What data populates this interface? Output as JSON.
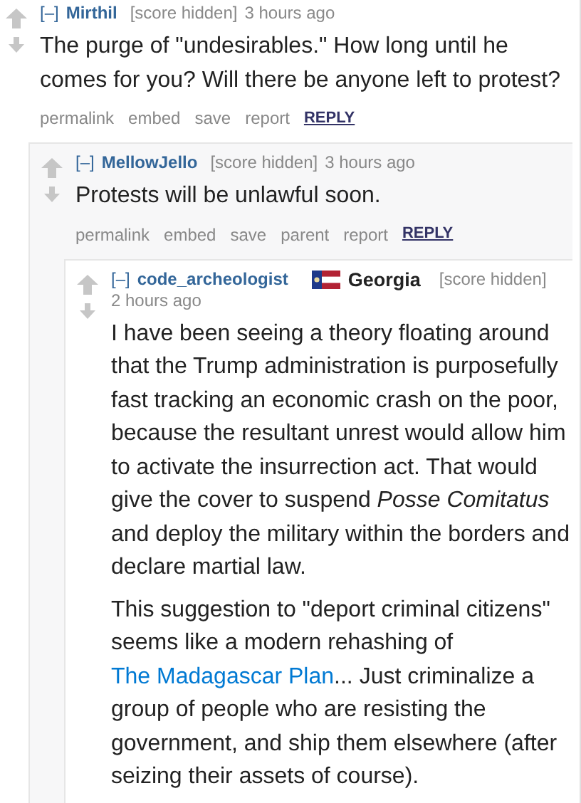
{
  "comments": [
    {
      "collapse": "[–]",
      "author": "Mirthil",
      "score": "[score hidden]",
      "time": "3 hours ago",
      "body": [
        [
          {
            "text": "The purge of \"undesirables.\" How long until he comes for you? Will there be anyone left to protest?"
          }
        ]
      ],
      "actions": [
        {
          "label": "permalink",
          "kind": "plain"
        },
        {
          "label": "embed",
          "kind": "plain"
        },
        {
          "label": "save",
          "kind": "plain"
        },
        {
          "label": "report",
          "kind": "plain"
        },
        {
          "label": "REPLY",
          "kind": "reply"
        }
      ],
      "children": [
        {
          "collapse": "[–]",
          "author": "MellowJello",
          "score": "[score hidden]",
          "time": "3 hours ago",
          "body": [
            [
              {
                "text": "Protests will be unlawful soon."
              }
            ]
          ],
          "actions": [
            {
              "label": "permalink",
              "kind": "plain"
            },
            {
              "label": "embed",
              "kind": "plain"
            },
            {
              "label": "save",
              "kind": "plain"
            },
            {
              "label": "parent",
              "kind": "plain"
            },
            {
              "label": "report",
              "kind": "plain"
            },
            {
              "label": "REPLY",
              "kind": "reply"
            }
          ],
          "children": [
            {
              "collapse": "[–]",
              "author": "code_archeologist",
              "flair": "Georgia",
              "score": "[score hidden]",
              "time": "2 hours ago",
              "body": [
                [
                  {
                    "text": "I have been seeing a theory floating around that the Trump administration is purposefully fast tracking an economic crash on the poor, because the resultant unrest would allow him to activate the insurrection act. That would give the cover to suspend *Posse Comitatus* and deploy the military within the borders and declare martial law."
                  }
                ],
                [
                  {
                    "text": "This suggestion to \"deport criminal citizens\" seems like a modern rehashing of "
                  },
                  {
                    "text": "The Madagascar Plan",
                    "link": true
                  },
                  {
                    "text": "... Just criminalize a group of people who are resisting the government, and ship them elsewhere (after seizing their assets of course)."
                  }
                ]
              ]
            }
          ]
        }
      ]
    }
  ]
}
